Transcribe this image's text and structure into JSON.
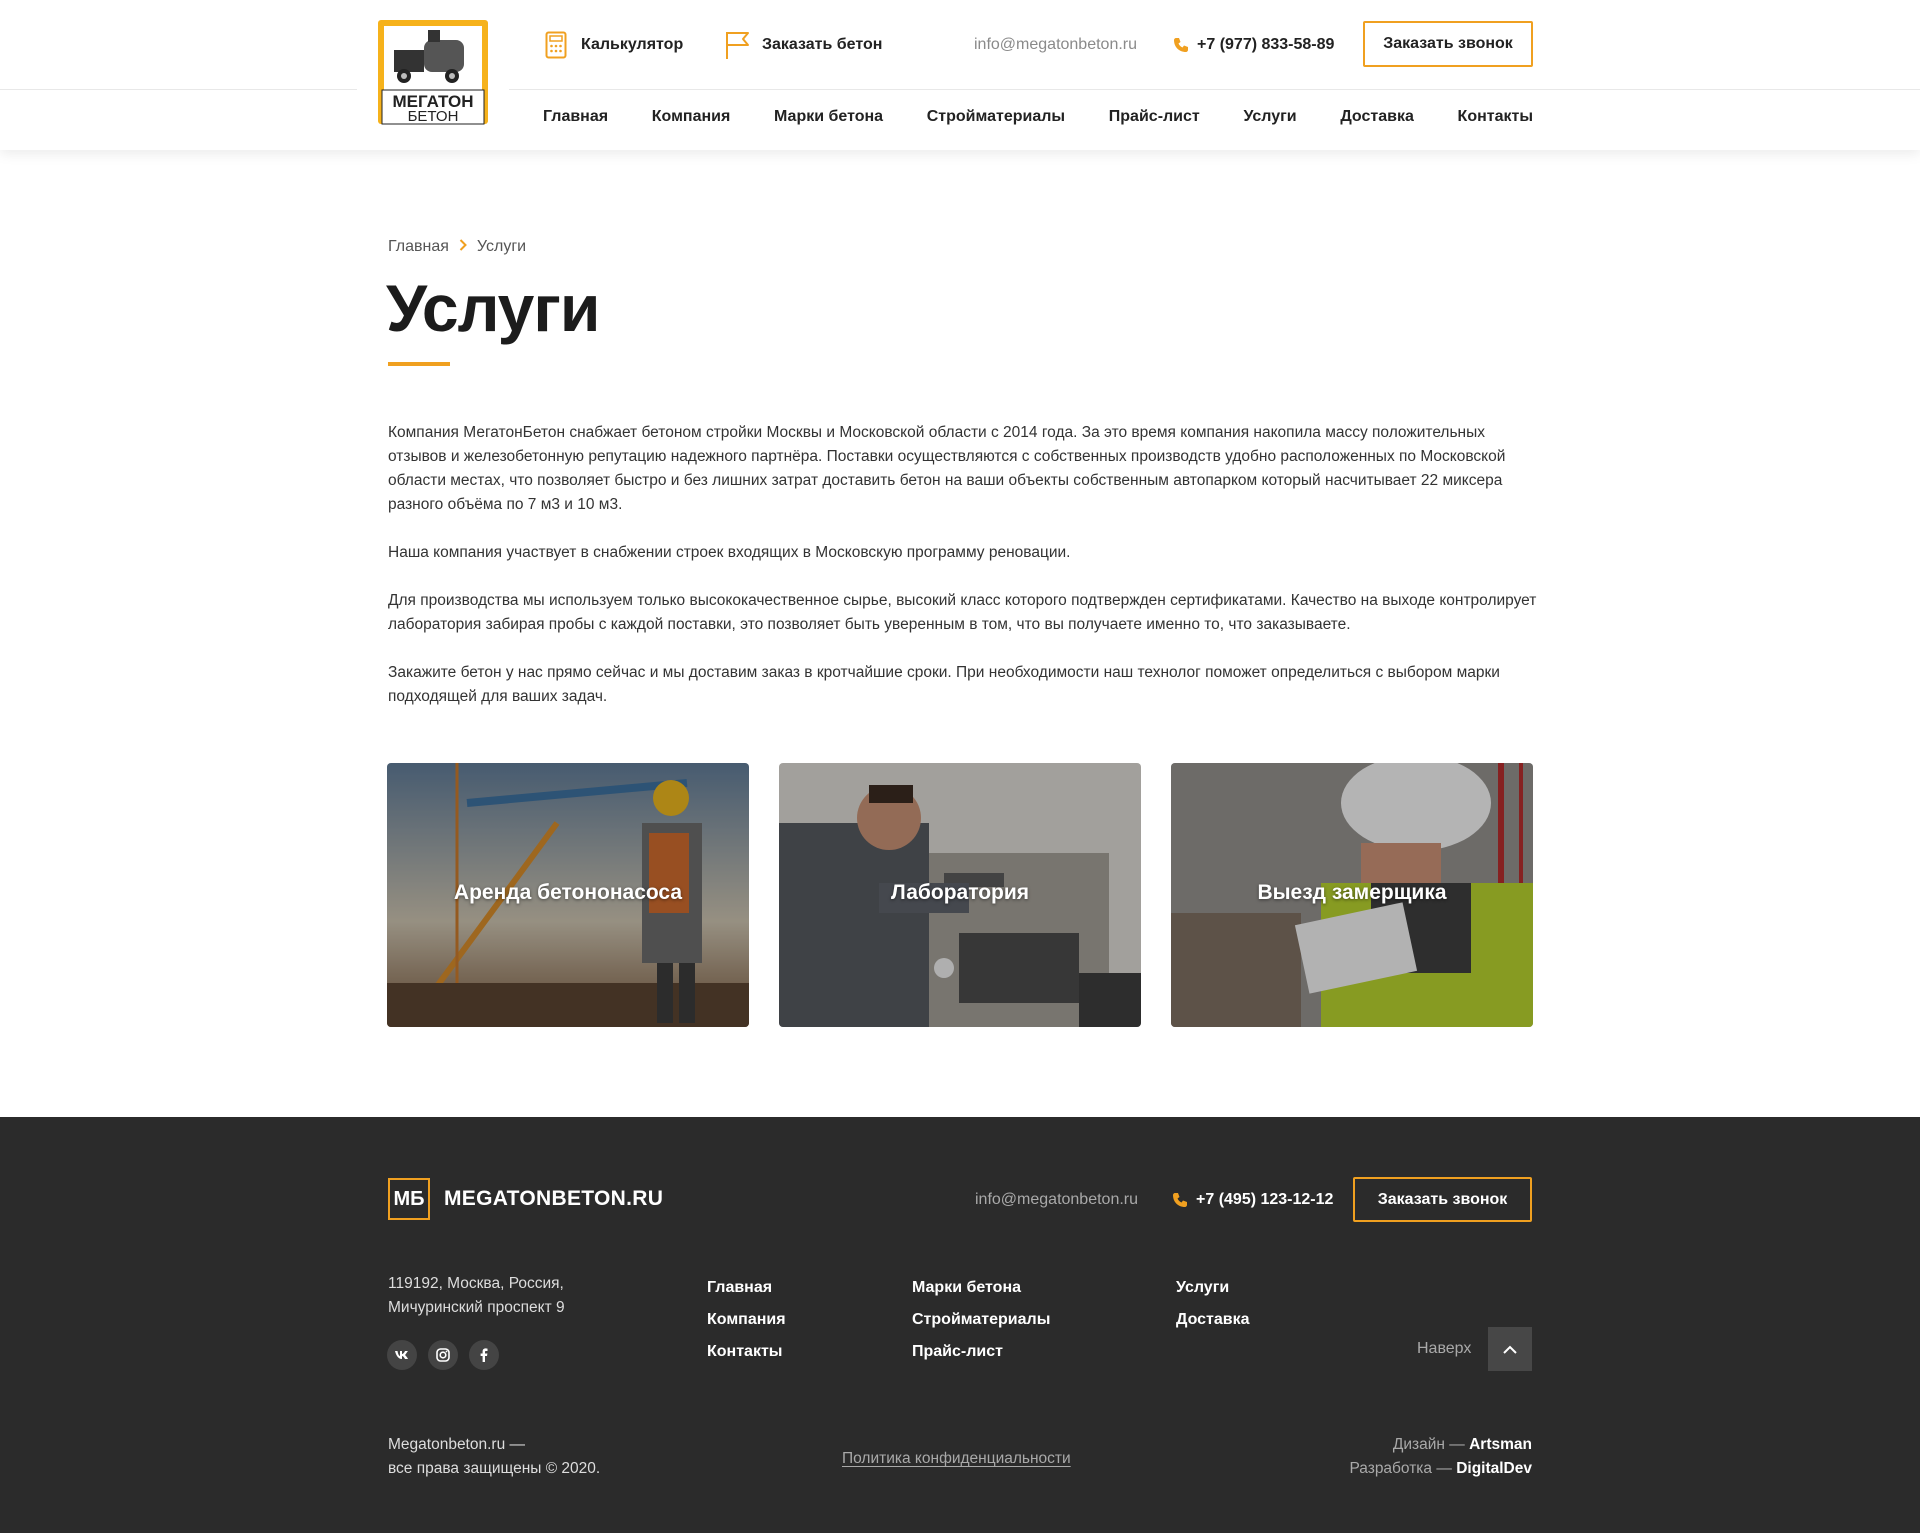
{
  "header": {
    "logo_line1": "МЕГАТОН",
    "logo_line2": "БЕТОН",
    "calculator_label": "Калькулятор",
    "order_concrete_label": "Заказать бетон",
    "email": "info@megatonbeton.ru",
    "phone": "+7 (977) 833-58-89",
    "call_button": "Заказать звонок",
    "nav": [
      "Главная",
      "Компания",
      "Марки бетона",
      "Стройматериалы",
      "Прайс-лист",
      "Услуги",
      "Доставка",
      "Контакты"
    ]
  },
  "breadcrumb": {
    "home": "Главная",
    "current": "Услуги"
  },
  "page_title": "Услуги",
  "intro": [
    "Компания МегатонБетон снабжает бетоном стройки Москвы и Московской области с 2014 года. За это время компания накопила массу положительных отзывов и железобетонную репутацию надежного партнёра. Поставки осуществляются с собственных производств удобно расположенных по Московской области местах, что позволяет быстро и без лишних затрат доставить бетон на ваши объекты собственным автопарком который насчитывает 22 миксера разного объёма по 7 м3 и 10 м3.",
    "Наша компания участвует в снабжении строек входящих в Московскую программу реновации.",
    "Для производства мы используем только высококачественное сырье, высокий класс которого подтвержден сертификатами. Качество на выходе контролирует лаборатория забирая пробы с каждой поставки, это позволяет быть уверенным в том, что вы получаете именно то, что заказываете.",
    "Закажите бетон у нас прямо сейчас и мы доставим заказ в кротчайшие сроки. При необходимости наш технолог поможет определиться с выбором марки подходящей для ваших задач."
  ],
  "cards": [
    {
      "label": "Аренда бетононасоса"
    },
    {
      "label": "Лаборатория"
    },
    {
      "label": "Выезд замерщика"
    }
  ],
  "footer": {
    "logo_mark": "МБ",
    "logo_text": "MEGATONBETON.RU",
    "email": "info@megatonbeton.ru",
    "phone": "+7 (495) 123-12-12",
    "call_button": "Заказать звонок",
    "address_line1": "119192, Москва, Россия,",
    "address_line2": "Мичуринский проспект 9",
    "social": [
      "vk-icon",
      "instagram-icon",
      "facebook-icon"
    ],
    "col1": [
      "Главная",
      "Компания",
      "Контакты"
    ],
    "col2": [
      "Марки бетона",
      "Стройматериалы",
      "Прайс-лист"
    ],
    "col3": [
      "Услуги",
      "Доставка"
    ],
    "to_top": "Наверх",
    "copy_line1": "Megatonbeton.ru —",
    "copy_line2": "все права защищены © 2020.",
    "policy": "Политика конфиденциальности",
    "design_label": "Дизайн —",
    "design_by": "Artsman",
    "dev_label": "Разработка —",
    "dev_by": "DigitalDev"
  },
  "colors": {
    "accent": "#f0a020",
    "footer_bg": "#2b2b2b",
    "text": "#222222"
  }
}
